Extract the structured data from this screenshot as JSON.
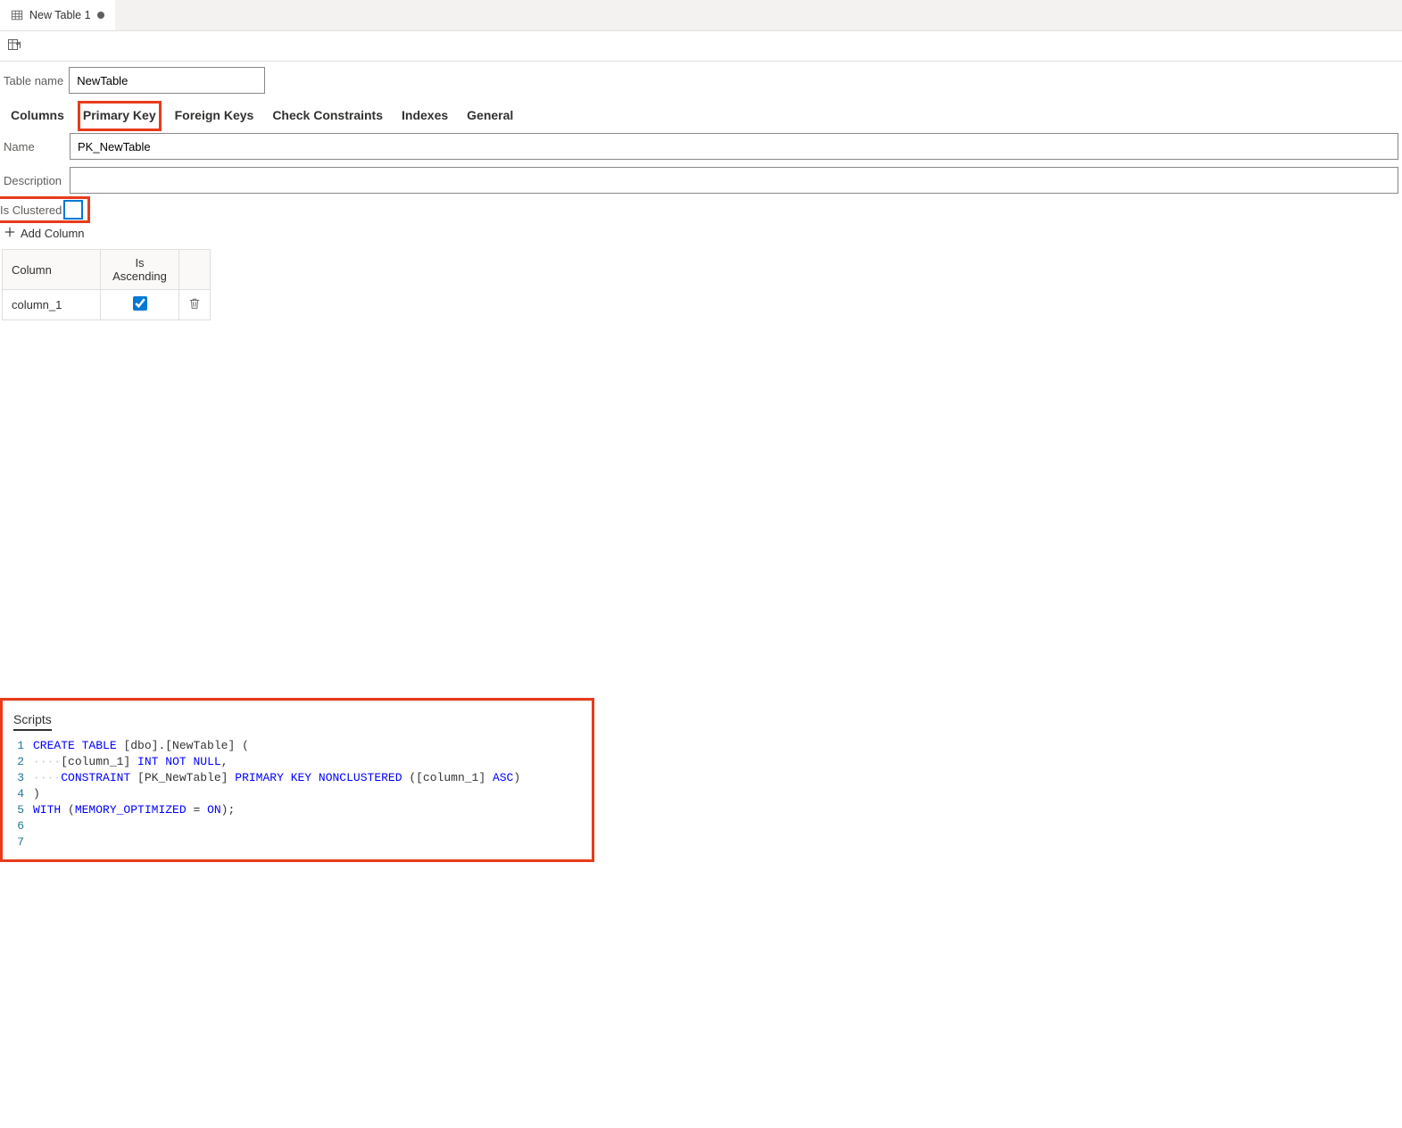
{
  "file_tab": {
    "label": "New Table 1"
  },
  "table_name": {
    "label": "Table name",
    "value": "NewTable"
  },
  "tabs": {
    "columns": "Columns",
    "primary_key": "Primary Key",
    "foreign_keys": "Foreign Keys",
    "check_constraints": "Check Constraints",
    "indexes": "Indexes",
    "general": "General"
  },
  "pk": {
    "name_label": "Name",
    "name_value": "PK_NewTable",
    "desc_label": "Description",
    "desc_value": "",
    "clustered_label": "Is Clustered",
    "add_column": "Add Column",
    "headers": {
      "col": "Column",
      "asc": "Is Ascending"
    },
    "rows": [
      {
        "col": "column_1",
        "asc": true
      }
    ]
  },
  "scripts": {
    "title": "Scripts",
    "lines": [
      {
        "n": "1",
        "t": [
          [
            "kw",
            "CREATE"
          ],
          [
            "txt",
            " "
          ],
          [
            "kw",
            "TABLE"
          ],
          [
            "txt",
            " [dbo].[NewTable] ("
          ]
        ]
      },
      {
        "n": "2",
        "t": [
          [
            "dots",
            "····"
          ],
          [
            "txt",
            "[column_1] "
          ],
          [
            "kw",
            "INT"
          ],
          [
            "txt",
            " "
          ],
          [
            "kw",
            "NOT"
          ],
          [
            "txt",
            " "
          ],
          [
            "kw",
            "NULL"
          ],
          [
            "txt",
            ","
          ]
        ]
      },
      {
        "n": "3",
        "t": [
          [
            "dots",
            "····"
          ],
          [
            "kw",
            "CONSTRAINT"
          ],
          [
            "txt",
            " [PK_NewTable] "
          ],
          [
            "kw",
            "PRIMARY"
          ],
          [
            "txt",
            " "
          ],
          [
            "kw",
            "KEY"
          ],
          [
            "txt",
            " "
          ],
          [
            "kw",
            "NONCLUSTERED"
          ],
          [
            "txt",
            " ([column_1] "
          ],
          [
            "kw",
            "ASC"
          ],
          [
            "txt",
            ")"
          ]
        ]
      },
      {
        "n": "4",
        "t": [
          [
            "txt",
            ")"
          ]
        ]
      },
      {
        "n": "5",
        "t": [
          [
            "kw",
            "WITH"
          ],
          [
            "txt",
            " ("
          ],
          [
            "kw",
            "MEMORY_OPTIMIZED"
          ],
          [
            "txt",
            " = "
          ],
          [
            "kw",
            "ON"
          ],
          [
            "txt",
            ");"
          ]
        ]
      },
      {
        "n": "6",
        "t": []
      },
      {
        "n": "7",
        "t": []
      }
    ]
  }
}
